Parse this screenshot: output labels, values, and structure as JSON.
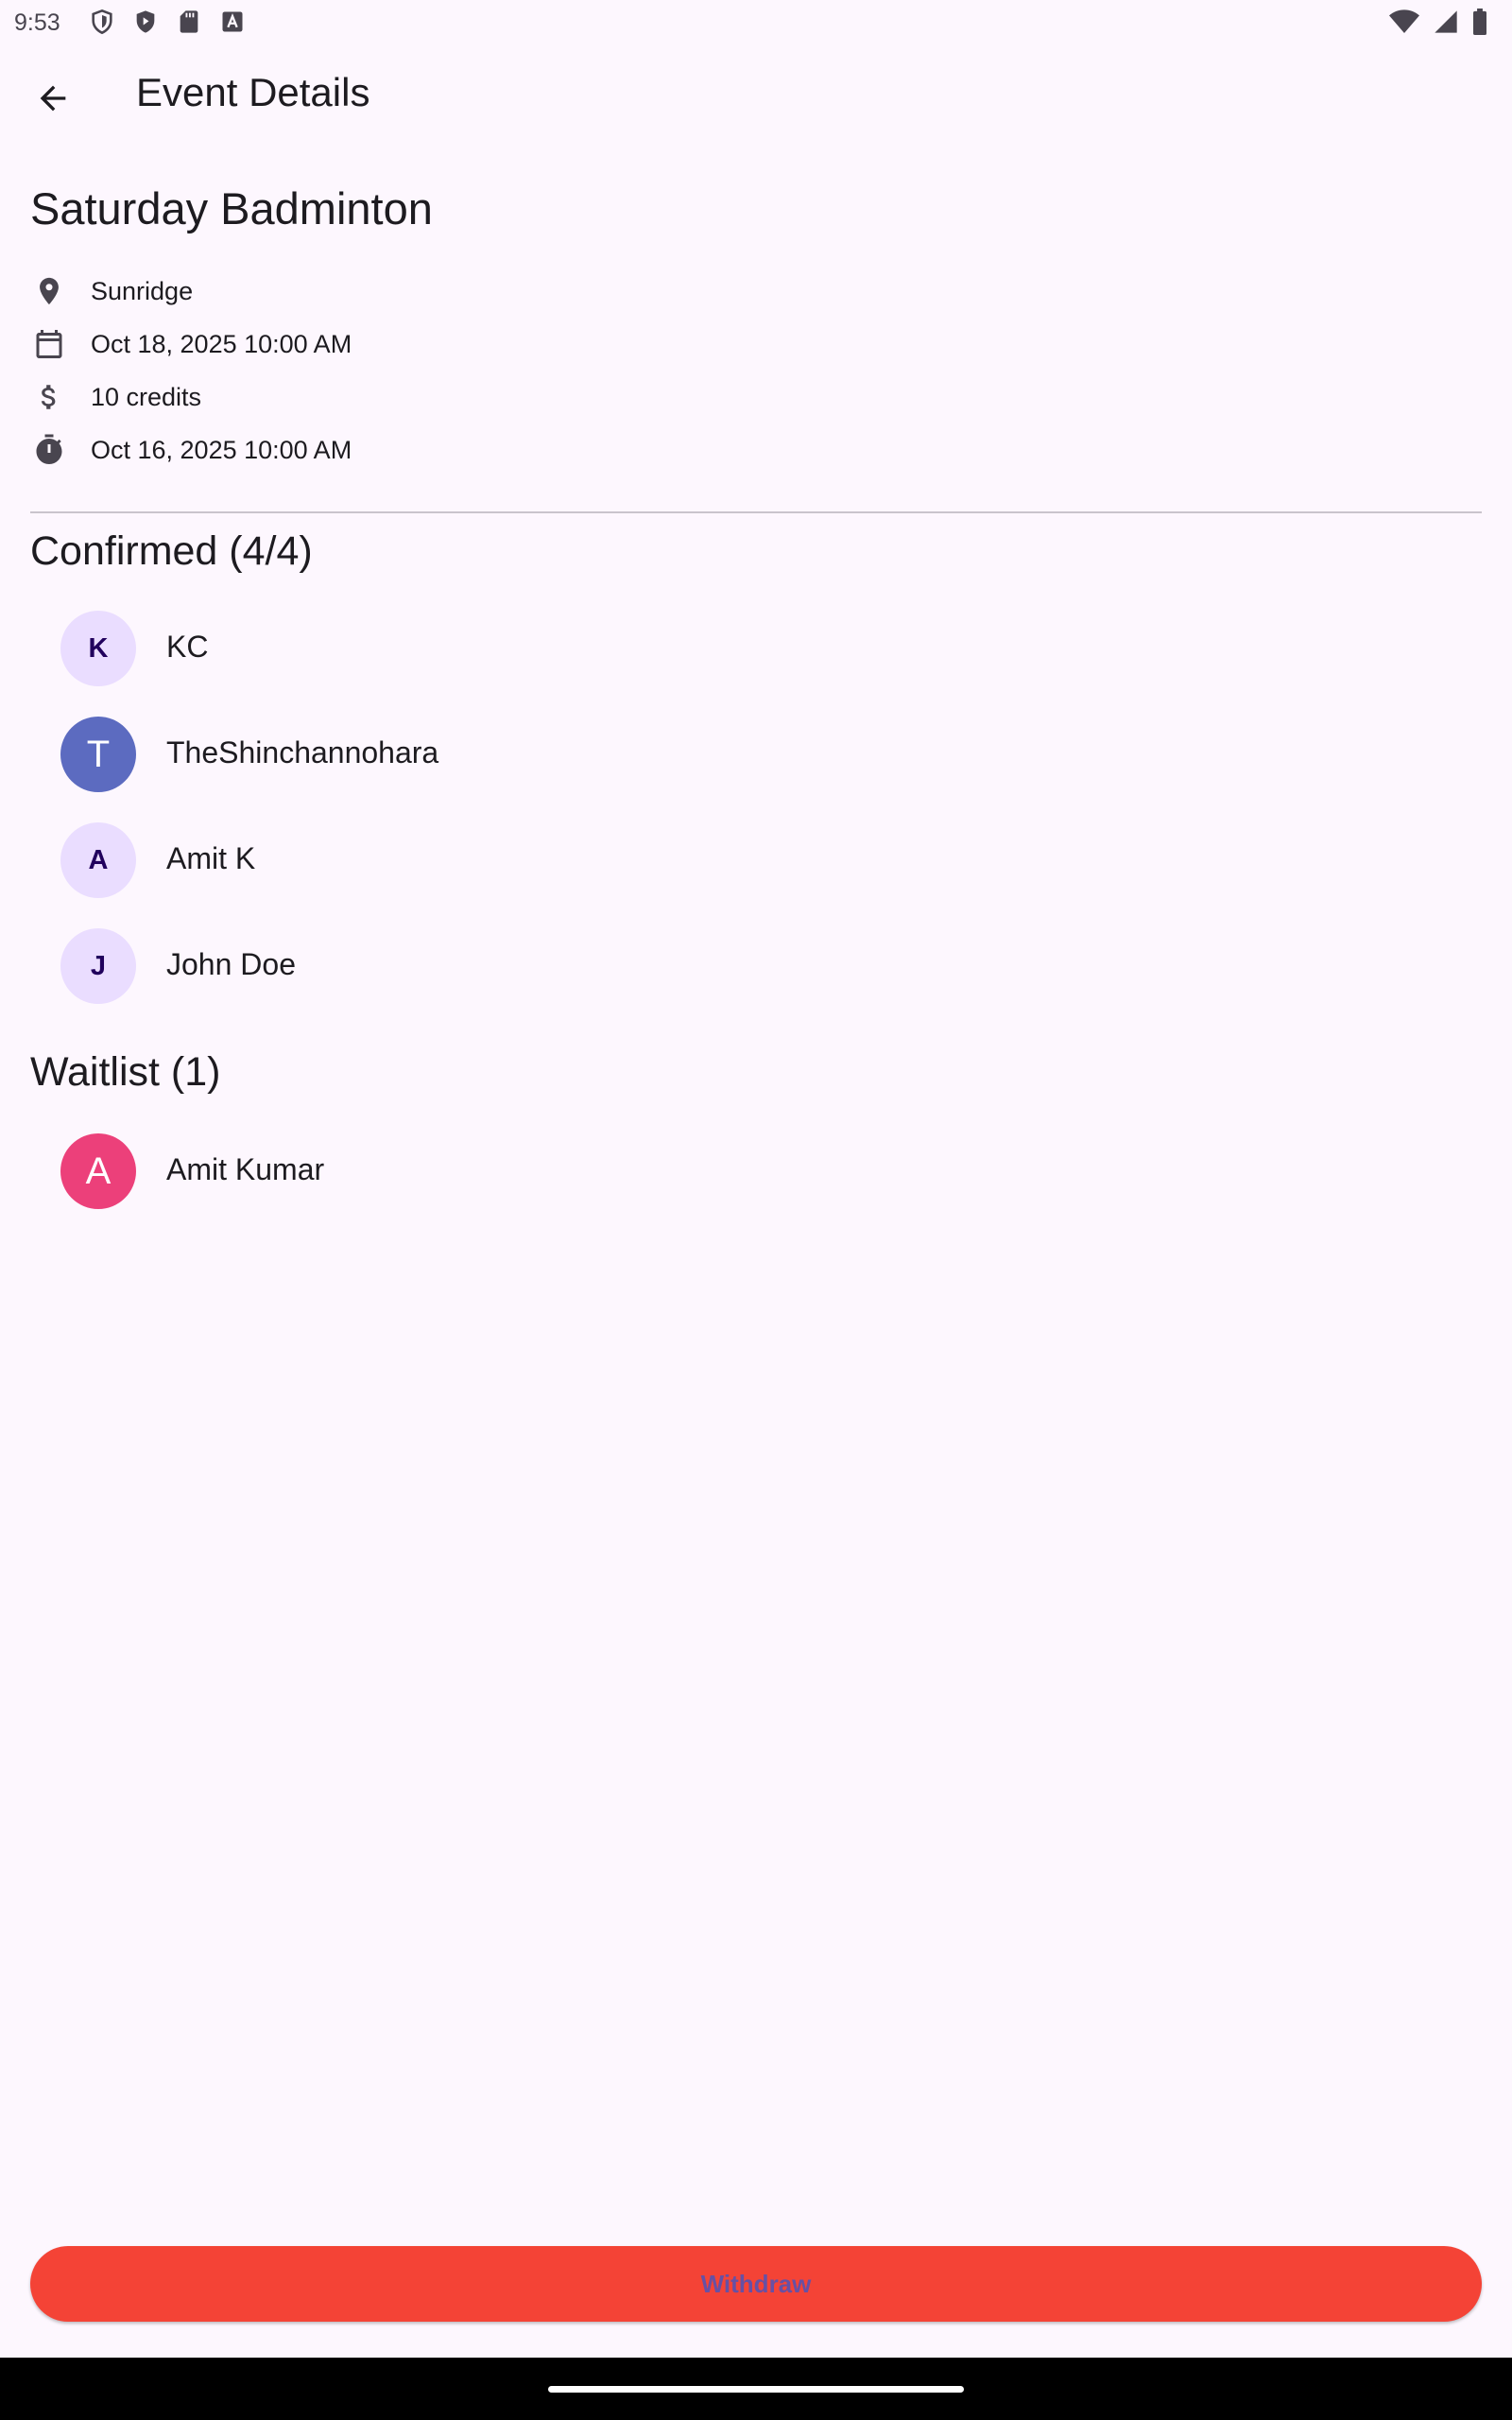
{
  "status_bar": {
    "time": "9:53",
    "icons_left": [
      "shield-icon",
      "play-protect-icon",
      "sd-card-icon",
      "app-icon"
    ],
    "icons_right": [
      "wifi-icon",
      "signal-icon",
      "battery-icon"
    ]
  },
  "app_bar": {
    "back_icon": "arrow-back-icon",
    "title": "Event Details"
  },
  "event": {
    "name": "Saturday Badminton",
    "details": [
      {
        "icon": "location-pin-icon",
        "text": "Sunridge"
      },
      {
        "icon": "calendar-icon",
        "text": "Oct 18, 2025 10:00 AM"
      },
      {
        "icon": "dollar-icon",
        "text": "10 credits"
      },
      {
        "icon": "timer-icon",
        "text": "Oct 16, 2025 10:00 AM"
      }
    ]
  },
  "confirmed": {
    "title": "Confirmed (4/4)",
    "people": [
      {
        "initial": "K",
        "name": "KC"
      },
      {
        "initial": "T",
        "name": "TheShinchannohara"
      },
      {
        "initial": "A",
        "name": "Amit K"
      },
      {
        "initial": "J",
        "name": "John Doe"
      }
    ]
  },
  "waitlist": {
    "title": "Waitlist (1)",
    "people": [
      {
        "initial": "A",
        "name": "Amit Kumar"
      }
    ]
  },
  "actions": {
    "withdraw_label": "Withdraw"
  },
  "colors": {
    "background": "#fdf7fe",
    "withdraw_button": "#f44336",
    "withdraw_text": "#6750a4",
    "avatar_light": "#eaddff",
    "avatar_indigo": "#5c6bc0",
    "avatar_pink": "#ec407a"
  }
}
